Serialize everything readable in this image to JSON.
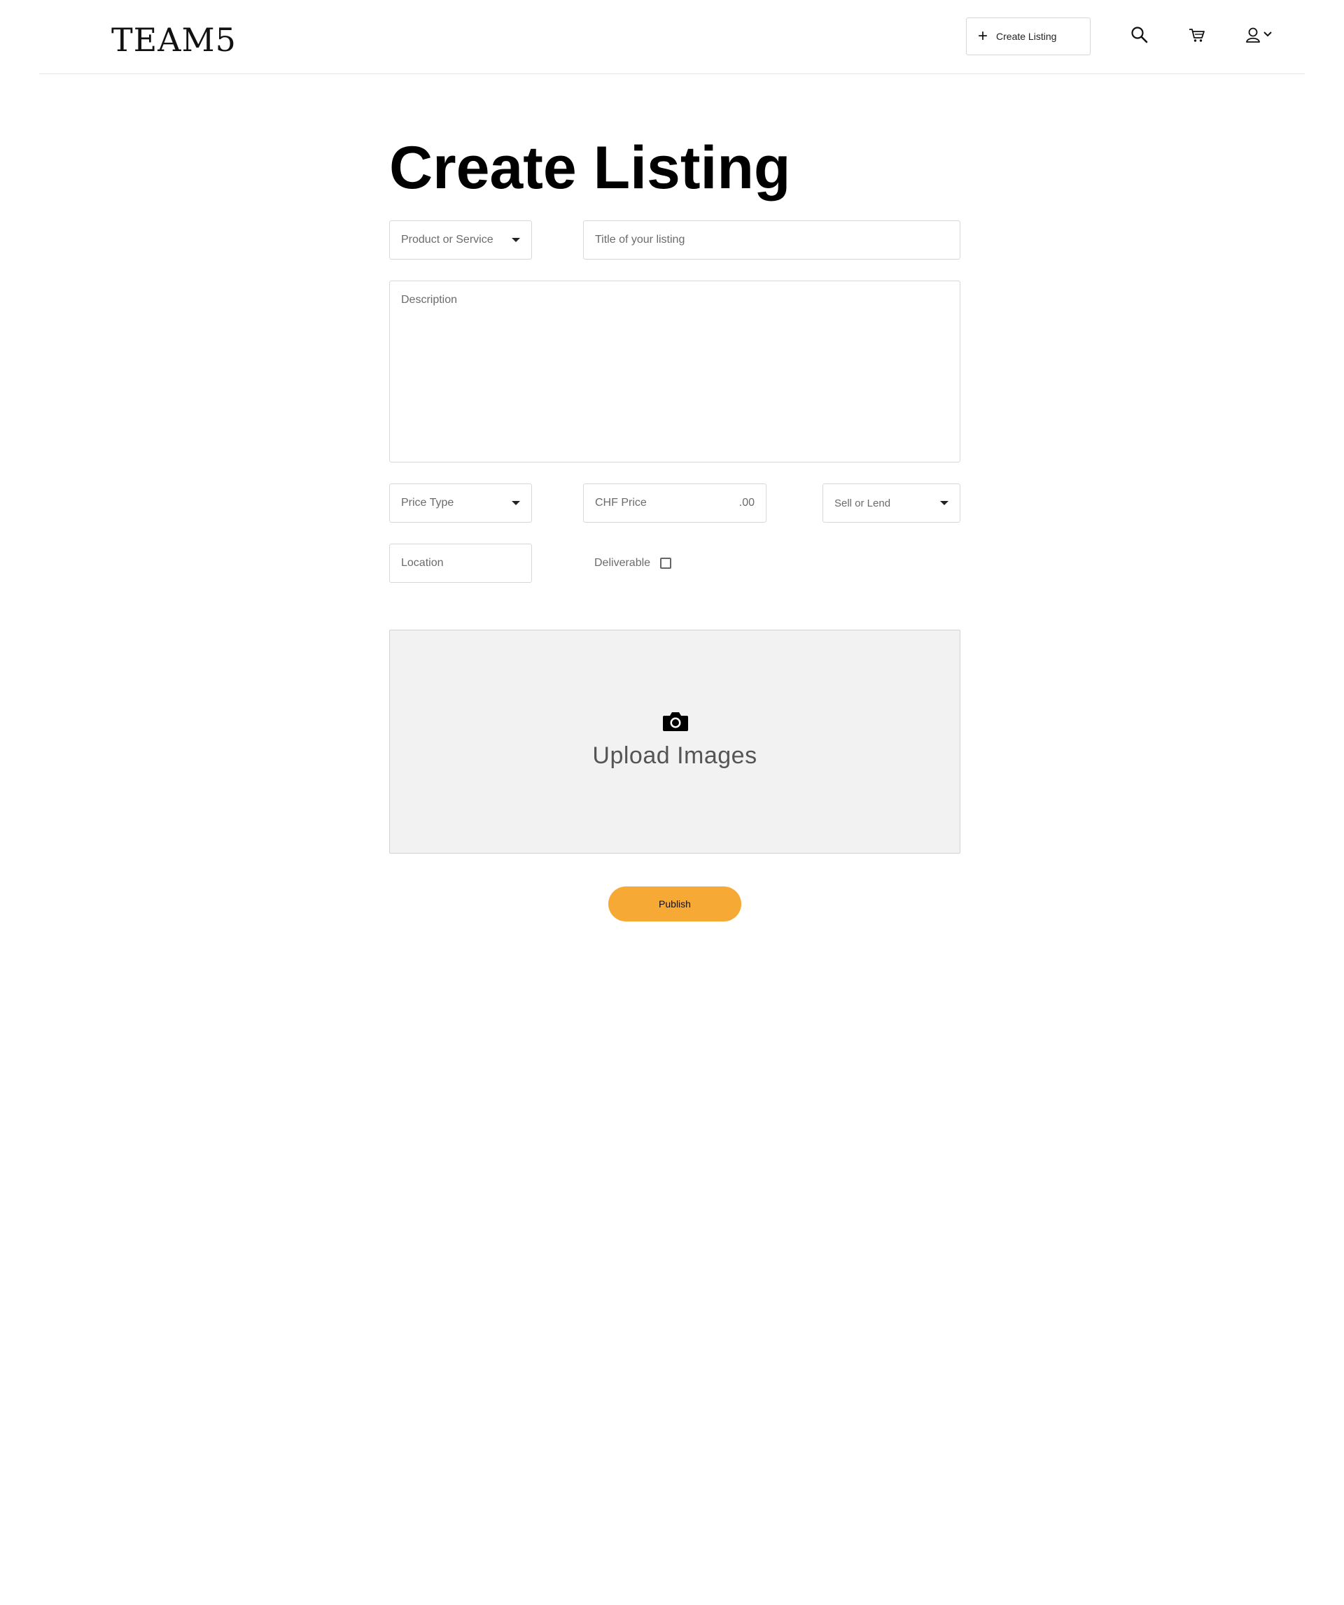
{
  "header": {
    "logo": "TEAM5",
    "create_listing_label": "Create Listing",
    "icons": [
      "plus-icon",
      "search-icon",
      "cart-icon",
      "user-icon",
      "chevron-down-icon"
    ]
  },
  "page": {
    "title": "Create Listing"
  },
  "form": {
    "product_or_service": {
      "placeholder": "Product or Service"
    },
    "listing_title": {
      "placeholder": "Title of your listing"
    },
    "description": {
      "placeholder": "Description"
    },
    "price_type": {
      "placeholder": "Price Type"
    },
    "price": {
      "placeholder": "CHF Price",
      "suffix": ".00"
    },
    "sell_or_lend": {
      "placeholder": "Sell or Lend"
    },
    "location": {
      "placeholder": "Location"
    },
    "deliverable": {
      "label": "Deliverable",
      "checked": false
    },
    "upload": {
      "label": "Upload Images",
      "icon": "camera-icon"
    },
    "publish_label": "Publish"
  },
  "colors": {
    "accent": "#f7a935",
    "upload_bg": "#f2f2f2",
    "border": "#d8d8d8"
  }
}
